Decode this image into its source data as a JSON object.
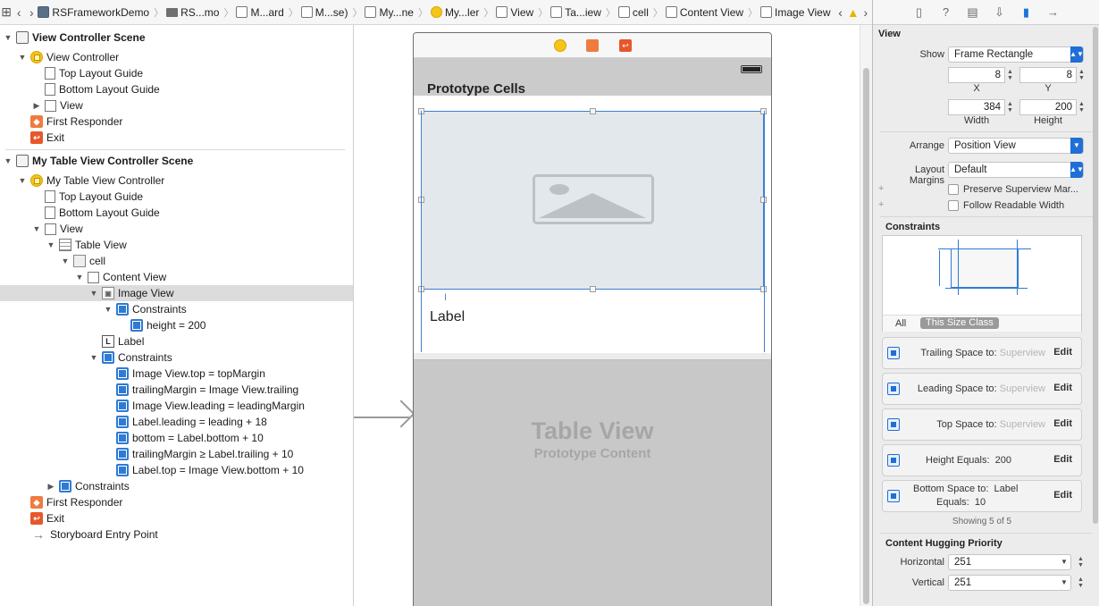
{
  "jumpbar": {
    "crumbs": [
      "RSFrameworkDemo",
      "RS...mo",
      "M...ard",
      "M...se)",
      "My...ne",
      "My...ler",
      "View",
      "Ta...iew",
      "cell",
      "Content View",
      "Image View"
    ]
  },
  "navigator": {
    "rows": [
      {
        "text": "View Controller Scene"
      },
      {
        "text": "View Controller"
      },
      {
        "text": "Top Layout Guide"
      },
      {
        "text": "Bottom Layout Guide"
      },
      {
        "text": "View"
      },
      {
        "text": "First Responder"
      },
      {
        "text": "Exit"
      },
      {
        "text": "My Table View Controller Scene"
      },
      {
        "text": "My Table View Controller"
      },
      {
        "text": "Top Layout Guide"
      },
      {
        "text": "Bottom Layout Guide"
      },
      {
        "text": "View"
      },
      {
        "text": "Table View"
      },
      {
        "text": "cell"
      },
      {
        "text": "Content View"
      },
      {
        "text": "Image View"
      },
      {
        "text": "Constraints"
      },
      {
        "text": "height = 200"
      },
      {
        "text": "Label"
      },
      {
        "text": "Constraints"
      },
      {
        "text": "Image View.top = topMargin"
      },
      {
        "text": "trailingMargin = Image View.trailing"
      },
      {
        "text": "Image View.leading = leadingMargin"
      },
      {
        "text": "Label.leading = leading + 18"
      },
      {
        "text": "bottom = Label.bottom + 10"
      },
      {
        "text": "trailingMargin ≥ Label.trailing + 10"
      },
      {
        "text": "Label.top = Image View.bottom + 10"
      },
      {
        "text": "Constraints"
      },
      {
        "text": "First Responder"
      },
      {
        "text": "Exit"
      },
      {
        "text": "Storyboard Entry Point"
      }
    ]
  },
  "canvas": {
    "prototype_title": "Prototype Cells",
    "cell_label": "Label",
    "tableview_title": "Table View",
    "tableview_subtitle": "Prototype Content"
  },
  "inspector": {
    "section_view": "View",
    "show_label": "Show",
    "show_value": "Frame Rectangle",
    "x_value": "8",
    "y_value": "8",
    "x_label": "X",
    "y_label": "Y",
    "width_value": "384",
    "height_value": "200",
    "width_label": "Width",
    "height_label": "Height",
    "arrange_label": "Arrange",
    "arrange_value": "Position View",
    "margins_label": "Layout Margins",
    "margins_value": "Default",
    "plus": "+",
    "preserve_label": "Preserve Superview Mar...",
    "readable_label": "Follow Readable Width",
    "constraints_title": "Constraints",
    "size_tab_all": "All",
    "size_tab_class": "This Size Class",
    "constraint_items": [
      {
        "label": "Trailing Space to:",
        "value": "Superview",
        "edit": "Edit"
      },
      {
        "label": "Leading Space to:",
        "value": "Superview",
        "edit": "Edit"
      },
      {
        "label": "Top Space to:",
        "value": "Superview",
        "edit": "Edit"
      },
      {
        "label": "Height Equals:",
        "value": "200",
        "edit": "Edit"
      },
      {
        "label": "Bottom Space to:",
        "value": "Label",
        "label2": "Equals:",
        "value2": "10",
        "edit": "Edit"
      }
    ],
    "showing": "Showing 5 of 5",
    "hugging_title": "Content Hugging Priority",
    "horizontal_label": "Horizontal",
    "horizontal_value": "251",
    "vertical_label": "Vertical",
    "vertical_value": "251"
  }
}
